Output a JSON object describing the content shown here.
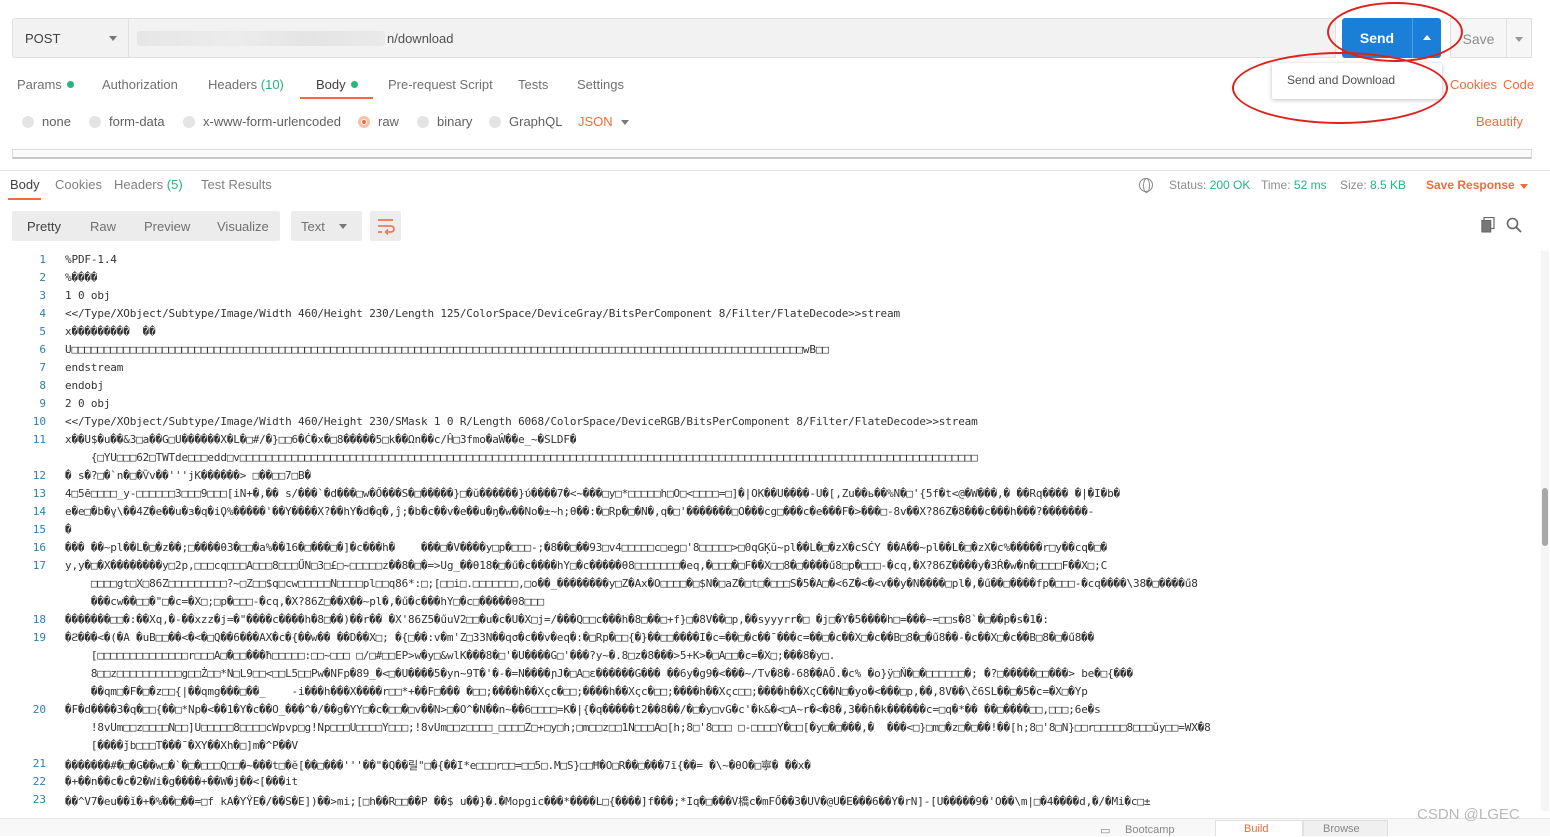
{
  "request": {
    "method": "POST",
    "url_visible": "n/download",
    "send_label": "Send",
    "save_label": "Save",
    "send_menu_item": "Send and Download"
  },
  "request_tabs": [
    {
      "label": "Params",
      "dot": true
    },
    {
      "label": "Authorization"
    },
    {
      "label": "Headers",
      "count": "(10)"
    },
    {
      "label": "Body",
      "dot": true,
      "active": true
    },
    {
      "label": "Pre-request Script"
    },
    {
      "label": "Tests"
    },
    {
      "label": "Settings"
    }
  ],
  "request_links": {
    "cookies": "Cookies",
    "code": "Code"
  },
  "body_types": [
    "none",
    "form-data",
    "x-www-form-urlencoded",
    "raw",
    "binary",
    "GraphQL"
  ],
  "body_type_selected": "raw",
  "raw_format": "JSON",
  "beautify_label": "Beautify",
  "response_tabs": [
    {
      "label": "Body",
      "active": true
    },
    {
      "label": "Cookies"
    },
    {
      "label": "Headers",
      "count": "(5)"
    },
    {
      "label": "Test Results"
    }
  ],
  "response_meta": {
    "status_label": "Status:",
    "status_value": "200 OK",
    "time_label": "Time:",
    "time_value": "52 ms",
    "size_label": "Size:",
    "size_value": "8.5 KB",
    "save_response": "Save Response"
  },
  "view_modes": [
    "Pretty",
    "Raw",
    "Preview",
    "Visualize"
  ],
  "view_format": "Text",
  "code_lines": [
    {
      "n": "1",
      "text": "%PDF-1.4"
    },
    {
      "n": "2",
      "text": "%����"
    },
    {
      "n": "3",
      "text": "1 0 obj"
    },
    {
      "n": "4",
      "text": "<</Type/XObject/Subtype/Image/Width 460/Height 230/Length 125/ColorSpace/DeviceGray/BitsPerComponent 8/Filter/FlateDecode>>stream"
    },
    {
      "n": "5",
      "text": "x���������  ��"
    },
    {
      "n": "6",
      "text": "U□□□□□□□□□□□□□□□□□□□□□□□□□□□□□□□□□□□□□□□□□□□□□□□□□□□□□□□□□□□□□□□□□□□□□□□□□□□□□□□□□□□□□□□□□□□□□□□□□□□□□□□□□□□□□□□□□wB□□"
    },
    {
      "n": "7",
      "text": "endstream"
    },
    {
      "n": "8",
      "text": "endobj"
    },
    {
      "n": "9",
      "text": "2 0 obj"
    },
    {
      "n": "10",
      "text": "<</Type/XObject/Subtype/Image/Width 460/Height 230/SMask 1 0 R/Length 6068/ColorSpace/DeviceRGB/BitsPerComponent 8/Filter/FlateDecode>>stream"
    },
    {
      "n": "11",
      "text": "x��U$�u��&3□a��G□U������X�L�□#/�}□□6�Ć�x�□8�����5□k��Ωn��c/Ĥ□3fmo�aŴ��e_~�SLDF�"
    },
    {
      "n": "",
      "text": "    {□YU□□□62□TWTde□□□edd□v□□□□□□□□□□□□□□□□□□□□□□□□□□□□□□□□□□□□□□□□□□□□□□□□□□□□□□□□□□□□□□□□□□□□□□□□□□□□□□□□□□□□□□□□□□□□□□□□□□□□□□□□□□□□□□□□□□"
    },
    {
      "n": "12",
      "text": "� s�?□�`n�□�Ѷv��'''jK������> □��□□7□B�"
    },
    {
      "n": "13",
      "text": "4□5ē□□□□_y-□□□□□□3□□□9□□□[iN+�,�� s/���`�d���□w�Ő���S�□�����}□�ŭ������}ύ����7�<~���□y□*□□□□□h□O□<□□□□=□]�|OK��U����-U�[,Zu��ь��%N�□'{5f�t<@�W���,� ��Rq���� �|�I�b�"
    },
    {
      "n": "14",
      "text": "e�e□�b�̥v\\��4Z�e��u�з�q�iϘ%�����'��Y����X?��hY�d�q�,ĵ;�b�c��v�e��u�ŋ�w��No�±~h;θ��:�□Rp�□�N�,q�□'�������□O���cg□���c�e���F�>���□-8v��X?86Z�8���c���h���?�������-"
    },
    {
      "n": "15",
      "text": "�"
    },
    {
      "n": "16",
      "text": "��� ��~pl��L�□�z��;□����θ3�□□�a%��16�□���□�]�c���h�    ���□�V����y□p�□□□-;�8��□��93□v4□□□□□c□eg□'8□□□□□>□0qGĶŭ~pl��L�□�zX�cSĆY ��A��~pl��L�□�zX�c%�����r□y��cq�□�"
    },
    {
      "n": "17",
      "text": "y,y�□�X��������y□2p,□□□cq□□□A□□□8□□□ŰN□3□£□~□□□□□z��8�□�=>Ug_��θ18�□�ű�c����hY□�c�����θ8□□□□□□□�eq,�□□□�□F��X□□8�□����ű8□p�□□□-�cq,�X?86Z����y�3Ŕ�w�n�□□□□F��X□;C"
    },
    {
      "n": "",
      "text": "    □□□□gt□X□86Z□□□□□□□□□?~□Z□□$q□cw□□□□□N□□□□pl□□q86*:□;[□□i□.□□□□□□□,□o��_��������y□Z�Ax�O□□□□�□$N�□aZ�□t□�□□□S�5�A□�<6Z�<�<v��y�N����□pl�,�ű��□����fp�□□□-�cq����\\38�□����ű8"
    },
    {
      "n": "",
      "text": "    ���cw��□□�\"□�c=�X□;□p�□□□-�cq,�X?86Z□��X��~pl�,�ű�c���hY□�c□�����θ8□□□"
    },
    {
      "n": "18",
      "text": "�������□□�:��Xq,�-��xzz�j=�\"����c����h�8□��)��r�� �X'86Z5�űuV2□□�u�c�U�X□j=/���Q□□c���h�8□��□+f}□�8V��□p,��syyyrr�□ �j□�Y�5����h□=���~=□□s�8`�□��p�s�1�:"
    },
    {
      "n": "19",
      "text": "�ϩ���<�(�A �uB□□��<�<�□Q��6���AX�c�{��w�� ��D��X□; �{□��:v�m'Z□33N��qσ�c��v�eq�:�□Rp�□□{�}��□□����I�c=��□�c��ˉ���c=��□�c��X□�c��B□8�□�ű8��-�c��X□�c��B□8�□�ű8��"
    },
    {
      "n": "",
      "text": "    [□□□□□□□□□□□□□□r□□□A□�□□���ħ□□□□□:□□~□□□ □/□#□□EP>w�y□&wlK���8�□'�U����G□'���?y~�.8□z�8���>5+K>�□A□□�c=�X□;���8�y□."
    },
    {
      "n": "",
      "text": "    8□□z□□□□□□□□□□g□□Ż□□*N□L9□□<□□L5□□Pw�NFp�89_�<□�U����5�yn~9T�'�-�=N����ɲJ�□A□ɛ������G��� ��6y�g9�<���~/Tv�8�-68��AÕ.�c% �o}ÿ□Ň�□�□□□□□□�; �?□�����□□���> be�□{���"
    },
    {
      "n": "",
      "text": "    ��qm□�F�□�z□□{|��qmg���□��_    -i���h���X����r□□*+��F□��� �□□;����h��Xςc�□□;����h��Xςc�□□;����h��Xςc□□;����h��XςC��N□�yo�<���□p,��,8V��\\č6SL��□�5�c=�X□�Yp"
    },
    {
      "n": "20",
      "text": "�F�d����3�q�□□{��□*Np�<��1�Y�c��O_���^�/��g�YY□�c�□□�□v��N>□�O^�N��n~��6□□□□=K�|{�q�����t2��8��/�□�y□vG�c'�k&�<□A~r�<�8�,3��ɦ�k������c=□q�*�� ��□����□□,□□□;6e�s"
    },
    {
      "n": "",
      "text": "    !8vUm□□z□□□□N□□]U□□□□□8□□□□cWpvp□g!Np□□□U□□□□Y□□□;!8vUm□□z□□□□_□□□□Z□+□y□h;□m□□z□□1N□□□A□[h;8□'8□□□ □-□□□□Y�□□[�y□�□���,�  ���<□}□m□�z□�□��!��[h;8□'8□N}□□r□□□□□8□□□ŭy□□=WX�8"
    },
    {
      "n": "",
      "text": "    [����ǰb□□□T���ˉ�XY��Xh�□]m�^P��V"
    },
    {
      "n": "21",
      "text": "�������#�□�G��w□�`�□�□□□Q□□�~���t□�ĕ[��□���'''��\"�Q��릴\"□�{��I*e□□□r□□=□□5□.M□S}□□Ħ�O□R��□���7ĩ{��= �\\~�θO�□寧� ��x�"
    },
    {
      "n": "22",
      "text": "�+��n��c�c�2�Wi�g����+��W�j��<[���it"
    },
    {
      "n": "23",
      "text": "��^V7�eu��ĭ�+�%��□��=□f kA�YŸE�/��S�E])��>mi;[□h��R□□��P ��$ u��}�.�Mopgic���*����L□{����]f���;*Iq�□���V橋c�mFŐ��3�UV�@U�E���6��Y�rN]-[U�����9�'O��\\m|□�4����d,�/�Mi�c□±"
    }
  ],
  "status_bar": {
    "bootcamp": "Bootcamp",
    "build": "Build",
    "browse": "Browse"
  },
  "watermark": "CSDN @LGEC"
}
